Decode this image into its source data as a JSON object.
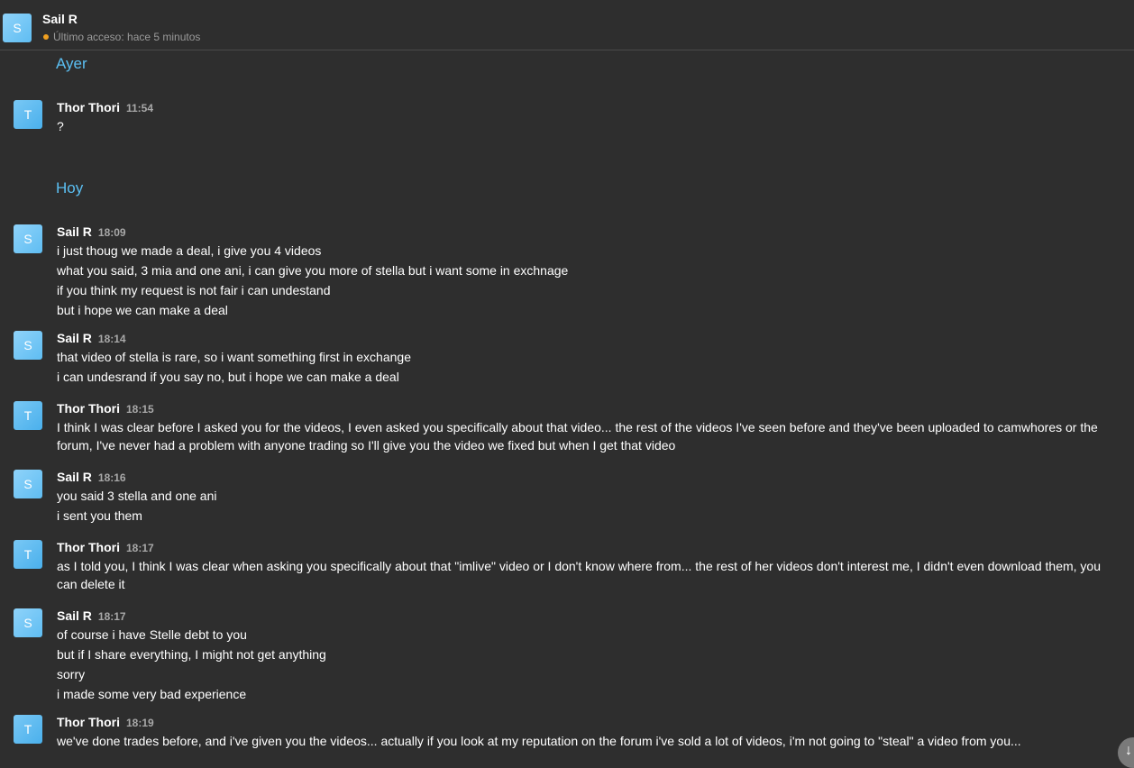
{
  "header": {
    "avatar_letter": "S",
    "title": "Sail R",
    "status": "Último acceso: hace 5 minutos",
    "status_color": "#f0a020"
  },
  "colors": {
    "background": "#2e2e2e",
    "accent": "#5bbff2",
    "avatar": "#4ab0ec"
  },
  "days": [
    {
      "label": "Ayer"
    },
    {
      "label": "Hoy"
    }
  ],
  "messages": [
    {
      "avatar": "T",
      "name": "Thor Thori",
      "time": "11:54",
      "lines": [
        "?"
      ]
    },
    {
      "avatar": "S",
      "name": "Sail R",
      "time": "18:09",
      "lines": [
        "i just thoug we made a deal, i give you 4 videos",
        "what you said, 3 mia and one ani, i can give you more of stella but i want some in exchnage",
        "if you think my request is not fair i can undestand",
        "but i hope we can make a deal"
      ]
    },
    {
      "avatar": "S",
      "name": "Sail R",
      "time": "18:14",
      "lines": [
        "that video of stella is rare, so i want something first in exchange",
        "i can undesrand if you say no, but i hope we can make a deal"
      ]
    },
    {
      "avatar": "T",
      "name": "Thor Thori",
      "time": "18:15",
      "lines": [
        "I think I was clear before I asked you for the videos, I even asked you specifically about that video... the rest of the videos I've seen before and they've been uploaded to camwhores or the forum, I've never had a problem with anyone trading so I'll give you the video we fixed but when I get that video"
      ]
    },
    {
      "avatar": "S",
      "name": "Sail R",
      "time": "18:16",
      "lines": [
        "you said 3 stella and one ani",
        "i sent you them"
      ]
    },
    {
      "avatar": "T",
      "name": "Thor Thori",
      "time": "18:17",
      "lines": [
        "as I told you, I think I was clear when asking you specifically about that \"imlive\" video or I don't know where from... the rest of her videos don't interest me, I didn't even download them, you can delete it"
      ]
    },
    {
      "avatar": "S",
      "name": "Sail R",
      "time": "18:17",
      "lines": [
        "of course i have Stelle debt to you",
        "but if I share everything, I might not get anything",
        "sorry",
        "i made some very bad experience"
      ]
    },
    {
      "avatar": "T",
      "name": "Thor Thori",
      "time": "18:19",
      "lines": [
        "we've done trades before, and i've given you the videos... actually if you look at my reputation on the forum i've sold a lot of videos, i'm not going to \"steal\" a video from you..."
      ]
    }
  ],
  "scroll_button": {
    "icon": "arrow-down-icon",
    "glyph": "↓"
  }
}
